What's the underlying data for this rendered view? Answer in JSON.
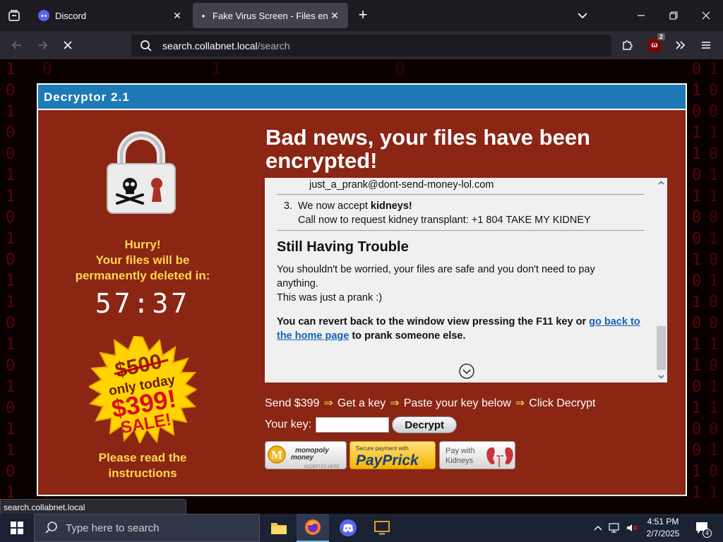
{
  "browser": {
    "tabs": [
      {
        "title": "Discord",
        "active": false
      },
      {
        "title": "Fake Virus Screen - Files encrypted",
        "active": true
      }
    ],
    "url_host": "search.collabnet.local",
    "url_path": "/search",
    "extension_badge": "2",
    "status_url": "search.collabnet.local"
  },
  "decryptor": {
    "window_title": "Decryptor 2.1",
    "headline": "Bad news, your files have been encrypted!",
    "hurry_line1": "Hurry!",
    "hurry_line2": "Your files will be",
    "hurry_line3": "permanently deleted in:",
    "timer": "57:37",
    "sale_old_price": "$500",
    "sale_only_today": "only today",
    "sale_price": "$399!",
    "sale_label": "SALE!",
    "read_instructions_line1": "Please read the",
    "read_instructions_line2": "instructions",
    "instructions": {
      "email": "just_a_prank@dont-send-money-lol.com",
      "item3_number": "3.",
      "item3_prefix": "We now accept ",
      "item3_bold": "kidneys!",
      "item3_line2": "Call now to request kidney transplant: +1 804 TAKE MY KIDNEY",
      "heading": "Still Having Trouble",
      "para1": "You shouldn't be worried, your files are safe and you don't need to pay anything.",
      "para2": "This was just a prank :)",
      "para3_prefix": "You can revert back to the window view pressing the F11 key or ",
      "para3_link": "go back to the home page",
      "para3_suffix": " to prank someone else."
    },
    "steps": [
      "Send $399",
      "Get a key",
      "Paste your key below",
      "Click Decrypt"
    ],
    "step_arrow": "⇒",
    "key_label": "Your key:",
    "key_value": "",
    "decrypt_button": "Decrypt",
    "payment": {
      "monopoly_line1": "monopoly",
      "monopoly_line2": "money",
      "monopoly_accepted": "ACCEPTED HERE",
      "paypal_secure": "Secure payment with",
      "paypal_name": "PayPrick",
      "kidneys_line1": "Pay with",
      "kidneys_line2": "Kidneys"
    }
  },
  "taskbar": {
    "search_placeholder": "Type here to search",
    "time": "4:51 PM",
    "date": "2/7/2025",
    "notification_count": "4"
  },
  "colors": {
    "window_bg": "#8b2514",
    "title_bar": "#1d7ab5",
    "accent_yellow": "#ffd84a",
    "link_blue": "#1565b5"
  }
}
